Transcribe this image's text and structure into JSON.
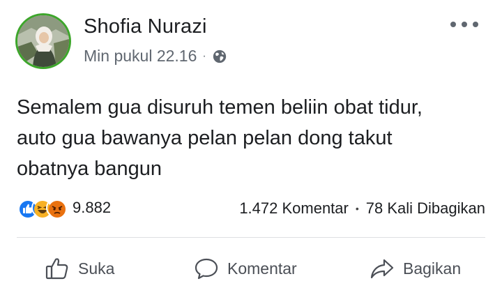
{
  "post": {
    "author": "Shofia Nurazi",
    "time": "Min pukul 22.16",
    "separator": "·",
    "privacy_icon": "globe-icon",
    "text_lines": [
      "Semalem gua disuruh temen beliin obat tidur,",
      "auto gua bawanya pelan pelan dong takut",
      "obatnya bangun"
    ]
  },
  "reactions": {
    "icons": [
      "like-reaction-icon",
      "haha-reaction-icon",
      "angry-reaction-icon"
    ],
    "count": "9.882"
  },
  "stats": {
    "comments": "1.472 Komentar",
    "separator": "•",
    "shares": "78 Kali Dibagikan"
  },
  "actions": {
    "like": "Suka",
    "comment": "Komentar",
    "share": "Bagikan"
  },
  "colors": {
    "text": "#1c1e21",
    "muted": "#606770",
    "like_blue": "#1877f2",
    "avatar_ring": "#3da62b",
    "angry": "#e9710f",
    "haha": "#f7b125"
  }
}
